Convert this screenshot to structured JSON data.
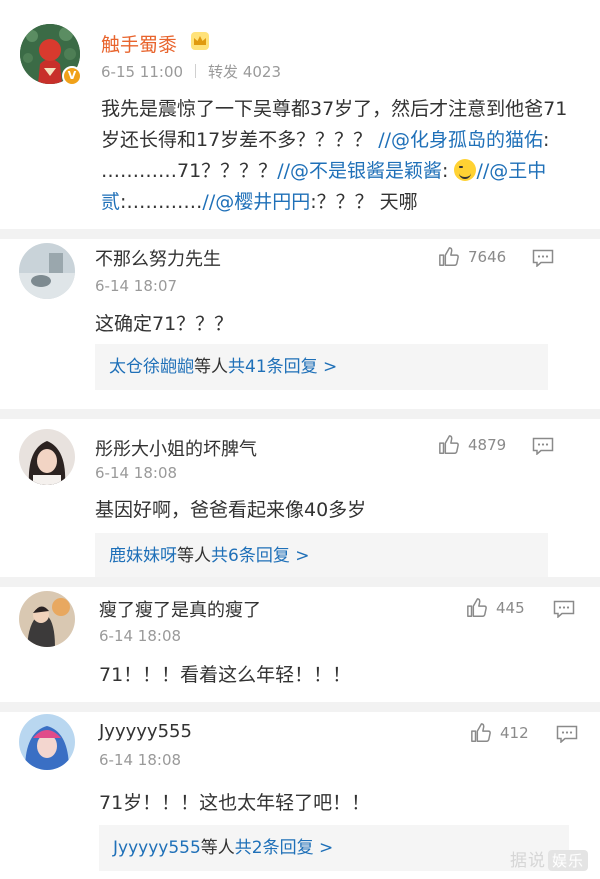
{
  "post": {
    "username": "触手蜀黍",
    "date": "6-15 11:00",
    "repost_label": "转发 4023",
    "text_segments": [
      {
        "t": "我先是震惊了一下吴尊都37岁了，然后才注意到他爸71岁还长得和17岁差不多？？？？ ",
        "at": false
      },
      {
        "t": "//@化身孤岛的猫佑",
        "at": true
      },
      {
        "t": ": …………71？？？？",
        "at": false
      },
      {
        "t": "//@不是银酱是颖酱",
        "at": true
      },
      {
        "t": ": ",
        "at": false
      },
      {
        "t": "[emoji]",
        "at": false,
        "emoji": true
      },
      {
        "t": "//@王中贰",
        "at": true
      },
      {
        "t": ":…………",
        "at": false
      },
      {
        "t": "//@樱井円円",
        "at": true
      },
      {
        "t": ":？？？ 天哪",
        "at": false
      }
    ],
    "vbadge": "V"
  },
  "comments": [
    {
      "user": "不那么努力先生",
      "time": "6-14 18:07",
      "likes": "7646",
      "text": "这确定71？？？",
      "reply_who": "太仓徐龅龅",
      "reply_etc": "等人",
      "reply_count": "共41条回复 >"
    },
    {
      "user": "彤彤大小姐的坏脾气",
      "time": "6-14 18:08",
      "likes": "4879",
      "text": "基因好啊，爸爸看起来像40多岁",
      "reply_who": "鹿妹妹呀",
      "reply_etc": "等人",
      "reply_count": "共6条回复 >"
    },
    {
      "user": "瘦了瘦了是真的瘦了",
      "time": "6-14 18:08",
      "likes": "445",
      "text": "71！！！看着这么年轻！！！"
    },
    {
      "user": "Jyyyyy555",
      "time": "6-14 18:08",
      "likes": "412",
      "text": "71岁！！！这也太年轻了吧！！",
      "reply_who": "Jyyyyy555",
      "reply_etc": "等人",
      "reply_count": "共2条回复 >"
    }
  ],
  "watermark": {
    "text": "据说",
    "tag": "娱乐"
  },
  "colors": {
    "username_orange": "#e8642d",
    "link_blue": "#1f70b8",
    "meta_gray": "#9a9a9a"
  }
}
